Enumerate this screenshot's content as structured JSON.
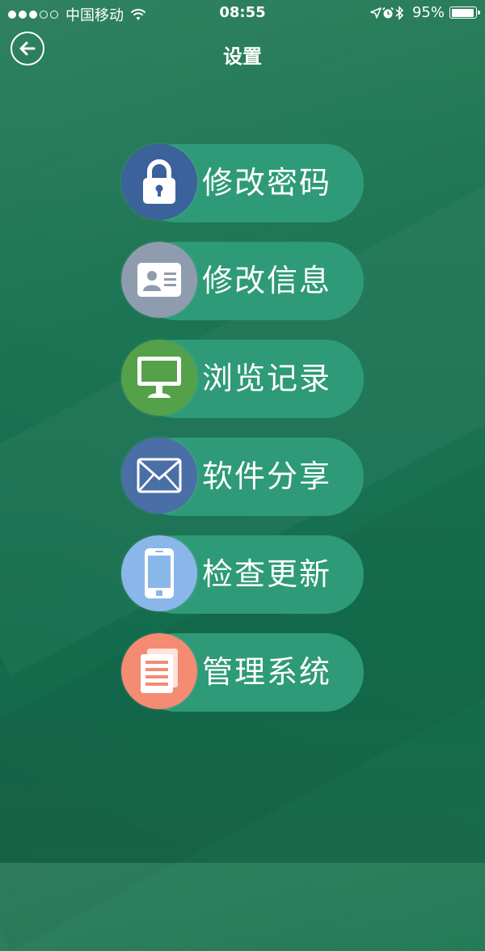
{
  "status_bar": {
    "signal_bars": 5,
    "signal_filled": 3,
    "carrier": "中国移动",
    "time": "08:55",
    "battery_percent": "95%",
    "battery_level": 0.95
  },
  "header": {
    "title": "设置"
  },
  "menu": {
    "items": [
      {
        "label": "修改密码",
        "icon": "lock-icon",
        "color": "#3b629b"
      },
      {
        "label": "修改信息",
        "icon": "id-card-icon",
        "color": "#8f9cae"
      },
      {
        "label": "浏览记录",
        "icon": "monitor-icon",
        "color": "#55a14a"
      },
      {
        "label": "软件分享",
        "icon": "mail-icon",
        "color": "#4a6fa6"
      },
      {
        "label": "检查更新",
        "icon": "phone-icon",
        "color": "#8ab7ea"
      },
      {
        "label": "管理系统",
        "icon": "documents-icon",
        "color": "#f48b72"
      }
    ]
  }
}
